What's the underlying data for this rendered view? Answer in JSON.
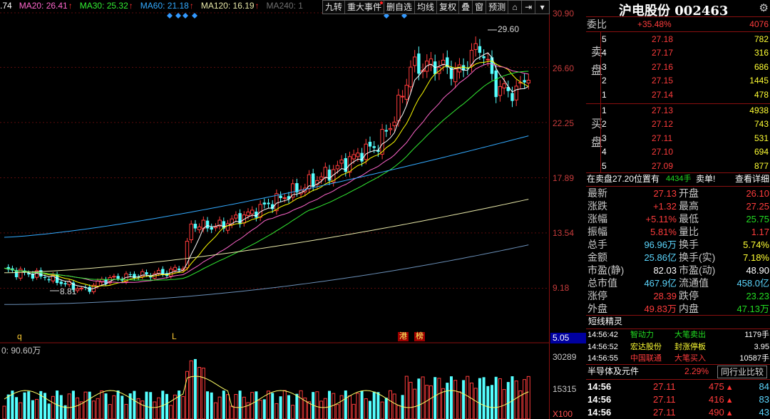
{
  "ma_legend": [
    {
      "label": ".74",
      "color": "#ffffff",
      "arrow": ""
    },
    {
      "label": "MA20: 26.41",
      "color": "#ff66cc",
      "arrow": "↑"
    },
    {
      "label": "MA30: 25.32",
      "color": "#33ee33",
      "arrow": "↑"
    },
    {
      "label": "MA60: 21.18",
      "color": "#33aaff",
      "arrow": "↑"
    },
    {
      "label": "MA120: 16.19",
      "color": "#e8e8a8",
      "arrow": "↑"
    },
    {
      "label": "MA240: 1",
      "color": "#707070",
      "arrow": ""
    }
  ],
  "toolbar": {
    "items": [
      "九转",
      "重大事件",
      "删自选",
      "均线",
      "复权",
      "叠",
      "窗",
      "预测"
    ],
    "flagged": [
      false,
      true,
      false,
      false,
      false,
      false,
      false,
      false
    ],
    "icons": [
      "lock-icon",
      "exit-icon",
      "dropdown-icon"
    ],
    "icon_glyphs": [
      "⌂",
      "⇥",
      "▾"
    ]
  },
  "price_axis": [
    "30.90",
    "26.60",
    "22.25",
    "17.89",
    "13.54",
    "9.18"
  ],
  "last_price_tag": "5.05",
  "volume_axis": [
    "30289",
    "15315",
    "X100"
  ],
  "volume_legend": "0: 90.60万",
  "peak_label": "29.60",
  "trough_label": "8.81",
  "markers": [
    {
      "text": "q",
      "kind": "letter"
    },
    {
      "text": "L",
      "kind": "letter"
    },
    {
      "text": "港",
      "kind": "tag"
    },
    {
      "text": "榜",
      "kind": "tag"
    }
  ],
  "chart_data": {
    "type": "candlestick",
    "price_range": [
      5.05,
      30.9
    ],
    "peak": 29.6,
    "trough": 8.81
  },
  "panel": {
    "title": "沪电股份 002463",
    "weibi": {
      "label": "委比",
      "pct": "+35.48%",
      "diff": "4076"
    },
    "sell_label": "卖盘",
    "buy_label": "买盘",
    "sell": [
      {
        "level": "5",
        "price": "27.18",
        "vol": "782"
      },
      {
        "level": "4",
        "price": "27.17",
        "vol": "316"
      },
      {
        "level": "3",
        "price": "27.16",
        "vol": "686"
      },
      {
        "level": "2",
        "price": "27.15",
        "vol": "1445"
      },
      {
        "level": "1",
        "price": "27.14",
        "vol": "478"
      }
    ],
    "buy": [
      {
        "level": "1",
        "price": "27.13",
        "vol": "4938"
      },
      {
        "level": "2",
        "price": "27.12",
        "vol": "743"
      },
      {
        "level": "3",
        "price": "27.11",
        "vol": "531"
      },
      {
        "level": "4",
        "price": "27.10",
        "vol": "694"
      },
      {
        "level": "5",
        "price": "27.09",
        "vol": "877"
      }
    ],
    "notice": {
      "prefix": "在卖盘27.20位置有",
      "qty": "4434手",
      "tail": "卖单!",
      "link": "查看详细"
    },
    "stats": [
      {
        "l1": "最新",
        "v1": "27.13",
        "c1": "red",
        "l2": "开盘",
        "v2": "26.10",
        "c2": "red"
      },
      {
        "l1": "涨跌",
        "v1": "+1.32",
        "c1": "red",
        "l2": "最高",
        "v2": "27.25",
        "c2": "red"
      },
      {
        "l1": "涨幅",
        "v1": "+5.11%",
        "c1": "red",
        "l2": "最低",
        "v2": "25.75",
        "c2": "green"
      },
      {
        "l1": "振幅",
        "v1": "5.81%",
        "c1": "red",
        "l2": "量比",
        "v2": "1.17",
        "c2": "red"
      },
      {
        "l1": "总手",
        "v1": "96.96万",
        "c1": "cyan",
        "l2": "换手",
        "v2": "5.74%",
        "c2": "yellow"
      },
      {
        "l1": "金额",
        "v1": "25.86亿",
        "c1": "cyan",
        "l2": "换手(实)",
        "v2": "7.18%",
        "c2": "yellow"
      },
      {
        "l1": "市盈(静)",
        "v1": "82.03",
        "c1": "white",
        "l2": "市盈(动)",
        "v2": "48.90",
        "c2": "white"
      },
      {
        "l1": "总市值",
        "v1": "467.9亿",
        "c1": "cyan",
        "l2": "流通值",
        "v2": "458.0亿",
        "c2": "cyan"
      },
      {
        "l1": "涨停",
        "v1": "28.39",
        "c1": "red",
        "l2": "跌停",
        "v2": "23.23",
        "c2": "green"
      },
      {
        "l1": "外盘",
        "v1": "49.83万",
        "c1": "red",
        "l2": "内盘",
        "v2": "47.13万",
        "c2": "green"
      }
    ],
    "elf_title": "短线精灵",
    "elf": [
      {
        "time": "14:56:42",
        "name": "智动力",
        "action": "大笔卖出",
        "value": "1179手",
        "ac": "green"
      },
      {
        "time": "14:56:52",
        "name": "宏达股份",
        "action": "封涨停板",
        "value": "3.95",
        "ac": "yellow"
      },
      {
        "time": "14:56:55",
        "name": "中国联通",
        "action": "大笔买入",
        "value": "10587手",
        "ac": "red"
      }
    ],
    "sector": {
      "name": "半导体及元件",
      "pct": "2.29%",
      "compare": "同行业比较"
    },
    "ticks": [
      {
        "time": "14:56",
        "price": "27.11",
        "vol": "475",
        "extra": "84"
      },
      {
        "time": "14:56",
        "price": "27.11",
        "vol": "416",
        "extra": "83"
      },
      {
        "time": "14:56",
        "price": "27.11",
        "vol": "490",
        "extra": "43"
      }
    ]
  }
}
